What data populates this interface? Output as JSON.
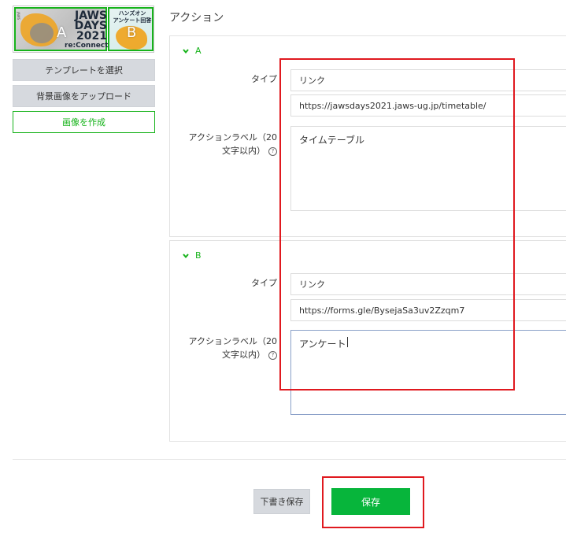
{
  "sidebar": {
    "preview": {
      "zone_a_label": "A",
      "zone_b_label": "B",
      "logo_line1": "JAWS",
      "logo_line2": "DAYS",
      "logo_line3": "2021",
      "logo_line4": "re:Connect",
      "zone_b_caption_line1": "ハンズオン",
      "zone_b_caption_line2": "アンケート回答"
    },
    "select_template_label": "テンプレートを選択",
    "upload_background_label": "背景画像をアップロード",
    "create_image_label": "画像を作成"
  },
  "main": {
    "title": "アクション",
    "actions": [
      {
        "header": "A",
        "type_label": "タイプ",
        "type_value": "リンク",
        "url_value": "https://jawsdays2021.jaws-ug.jp/timetable/",
        "action_label_label_line1": "アクションラベル（20",
        "action_label_label_line2": "文字以内）",
        "action_label_value": "タイムテーブル"
      },
      {
        "header": "B",
        "type_label": "タイプ",
        "type_value": "リンク",
        "url_value": "https://forms.gle/BysejaSa3uv2Zzqm7",
        "action_label_label_line1": "アクションラベル（20",
        "action_label_label_line2": "文字以内）",
        "action_label_value": "アンケート"
      }
    ]
  },
  "footer": {
    "draft_save_label": "下書き保存",
    "save_label": "保存"
  },
  "colors": {
    "accent_green": "#17b31b",
    "save_green": "#07b53b",
    "highlight_red": "#e0191f"
  }
}
